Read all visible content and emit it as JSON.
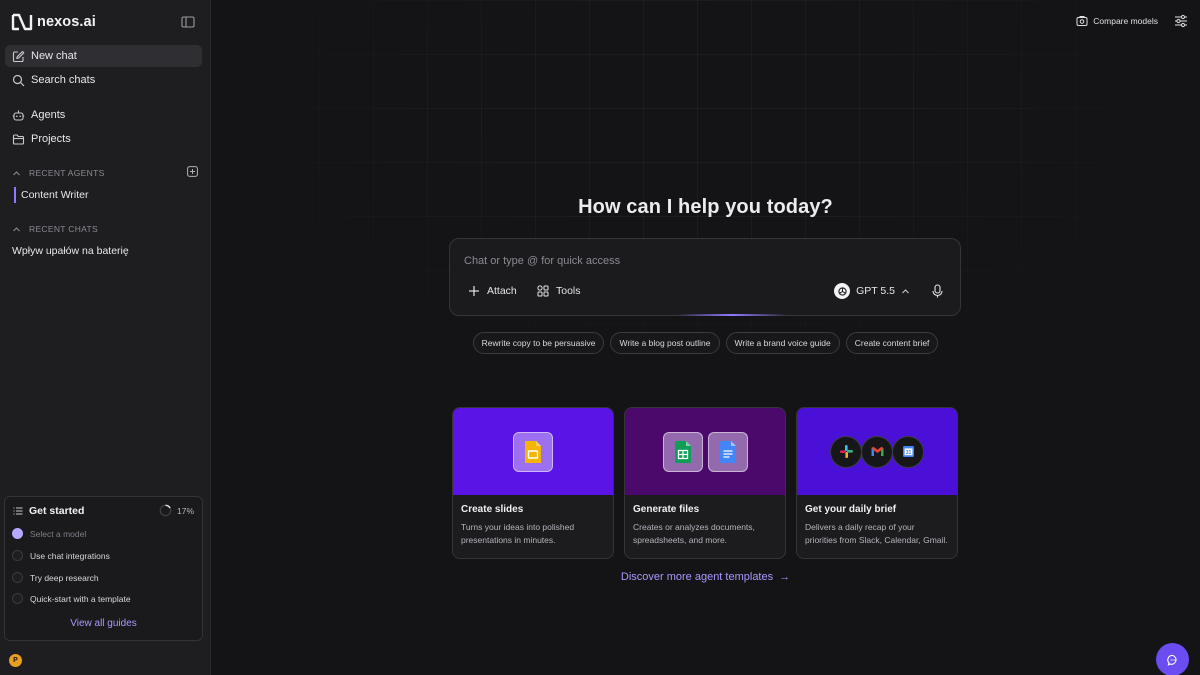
{
  "app": {
    "name": "nexos.ai"
  },
  "sidebar": {
    "new_chat": "New chat",
    "search_chats": "Search chats",
    "agents": "Agents",
    "projects": "Projects",
    "recent_agents_label": "RECENT AGENTS",
    "recent_agents": [
      "Content Writer"
    ],
    "recent_chats_label": "RECENT CHATS",
    "recent_chats": [
      "Wpływ upałów na baterię"
    ]
  },
  "guide": {
    "title": "Get started",
    "progress": "17%",
    "progress_value": 0.17,
    "steps": [
      {
        "label": "Select a model",
        "done": true
      },
      {
        "label": "Use chat integrations",
        "done": false
      },
      {
        "label": "Try deep research",
        "done": false
      },
      {
        "label": "Quick-start with a template",
        "done": false
      }
    ],
    "link": "View all guides"
  },
  "user": {
    "initial": "P"
  },
  "header": {
    "compare_models": "Compare models"
  },
  "main": {
    "headline": "How can I help you today?",
    "composer": {
      "placeholder": "Chat or type @ for quick access",
      "attach": "Attach",
      "tools": "Tools",
      "model": "GPT 5.5"
    },
    "suggestions": [
      "Rewrite copy to be persuasive",
      "Write a blog post outline",
      "Write a brand voice guide",
      "Create content brief"
    ],
    "cards": [
      {
        "title": "Create slides",
        "desc": "Turns your ideas into polished presentations in minutes."
      },
      {
        "title": "Generate files",
        "desc": "Creates or analyzes documents, spreadsheets, and more."
      },
      {
        "title": "Get your daily brief",
        "desc": "Delivers a daily recap of your priorities from Slack, Calendar, Gmail."
      }
    ],
    "discover_link": "Discover more agent templates",
    "discover_arrow": "→"
  },
  "colors": {
    "background": "#141416",
    "sidebar": "#1e1e21",
    "accent": "#8f7bff",
    "card_slides": "#5b14e6",
    "card_files": "#4b0a6b",
    "card_brief": "#4b10d8"
  }
}
